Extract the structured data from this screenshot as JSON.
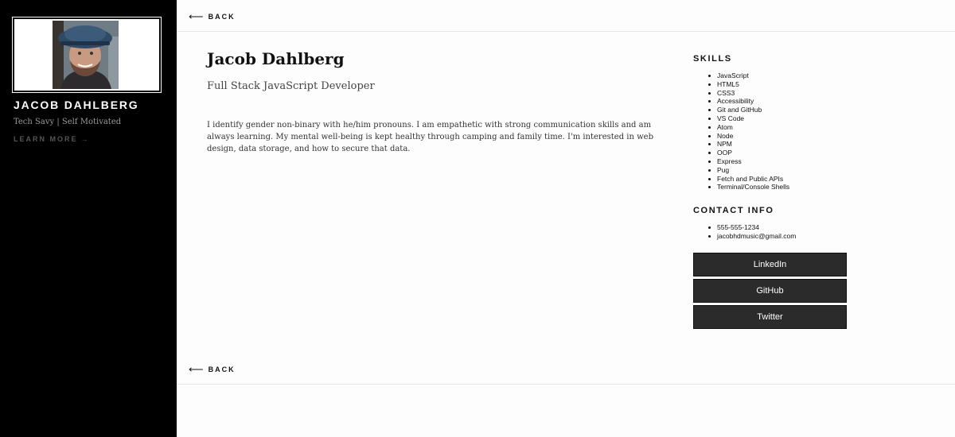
{
  "sidebar": {
    "name": "JACOB DAHLBERG",
    "tagline": "Tech Savy | Self Motivated",
    "learn_more": "LEARN MORE",
    "learn_more_arrow": "→"
  },
  "nav": {
    "back_label": "BACK",
    "back_arrow": "⟵"
  },
  "main": {
    "name": "Jacob Dahlberg",
    "role": "Full Stack JavaScript Developer",
    "bio": "I identify gender non-binary with he/him pronouns. I am empathetic with strong communication skills and am always learning. My mental well-being is kept healthy through camping and family time. I'm interested in web design, data storage, and how to secure that data."
  },
  "skills": {
    "title": "SKILLS",
    "items": [
      "JavaScript",
      "HTML5",
      "CSS3",
      "Accessibility",
      "Git and GitHub",
      "VS Code",
      "Atom",
      "Node",
      "NPM",
      "OOP",
      "Express",
      "Pug",
      "Fetch and Public APIs",
      "Terminal/Console Shells"
    ]
  },
  "contact": {
    "title": "CONTACT INFO",
    "items": [
      "555-555-1234",
      "jacobhdmusic@gmail.com"
    ]
  },
  "links": [
    "LinkedIn",
    "GitHub",
    "Twitter"
  ]
}
